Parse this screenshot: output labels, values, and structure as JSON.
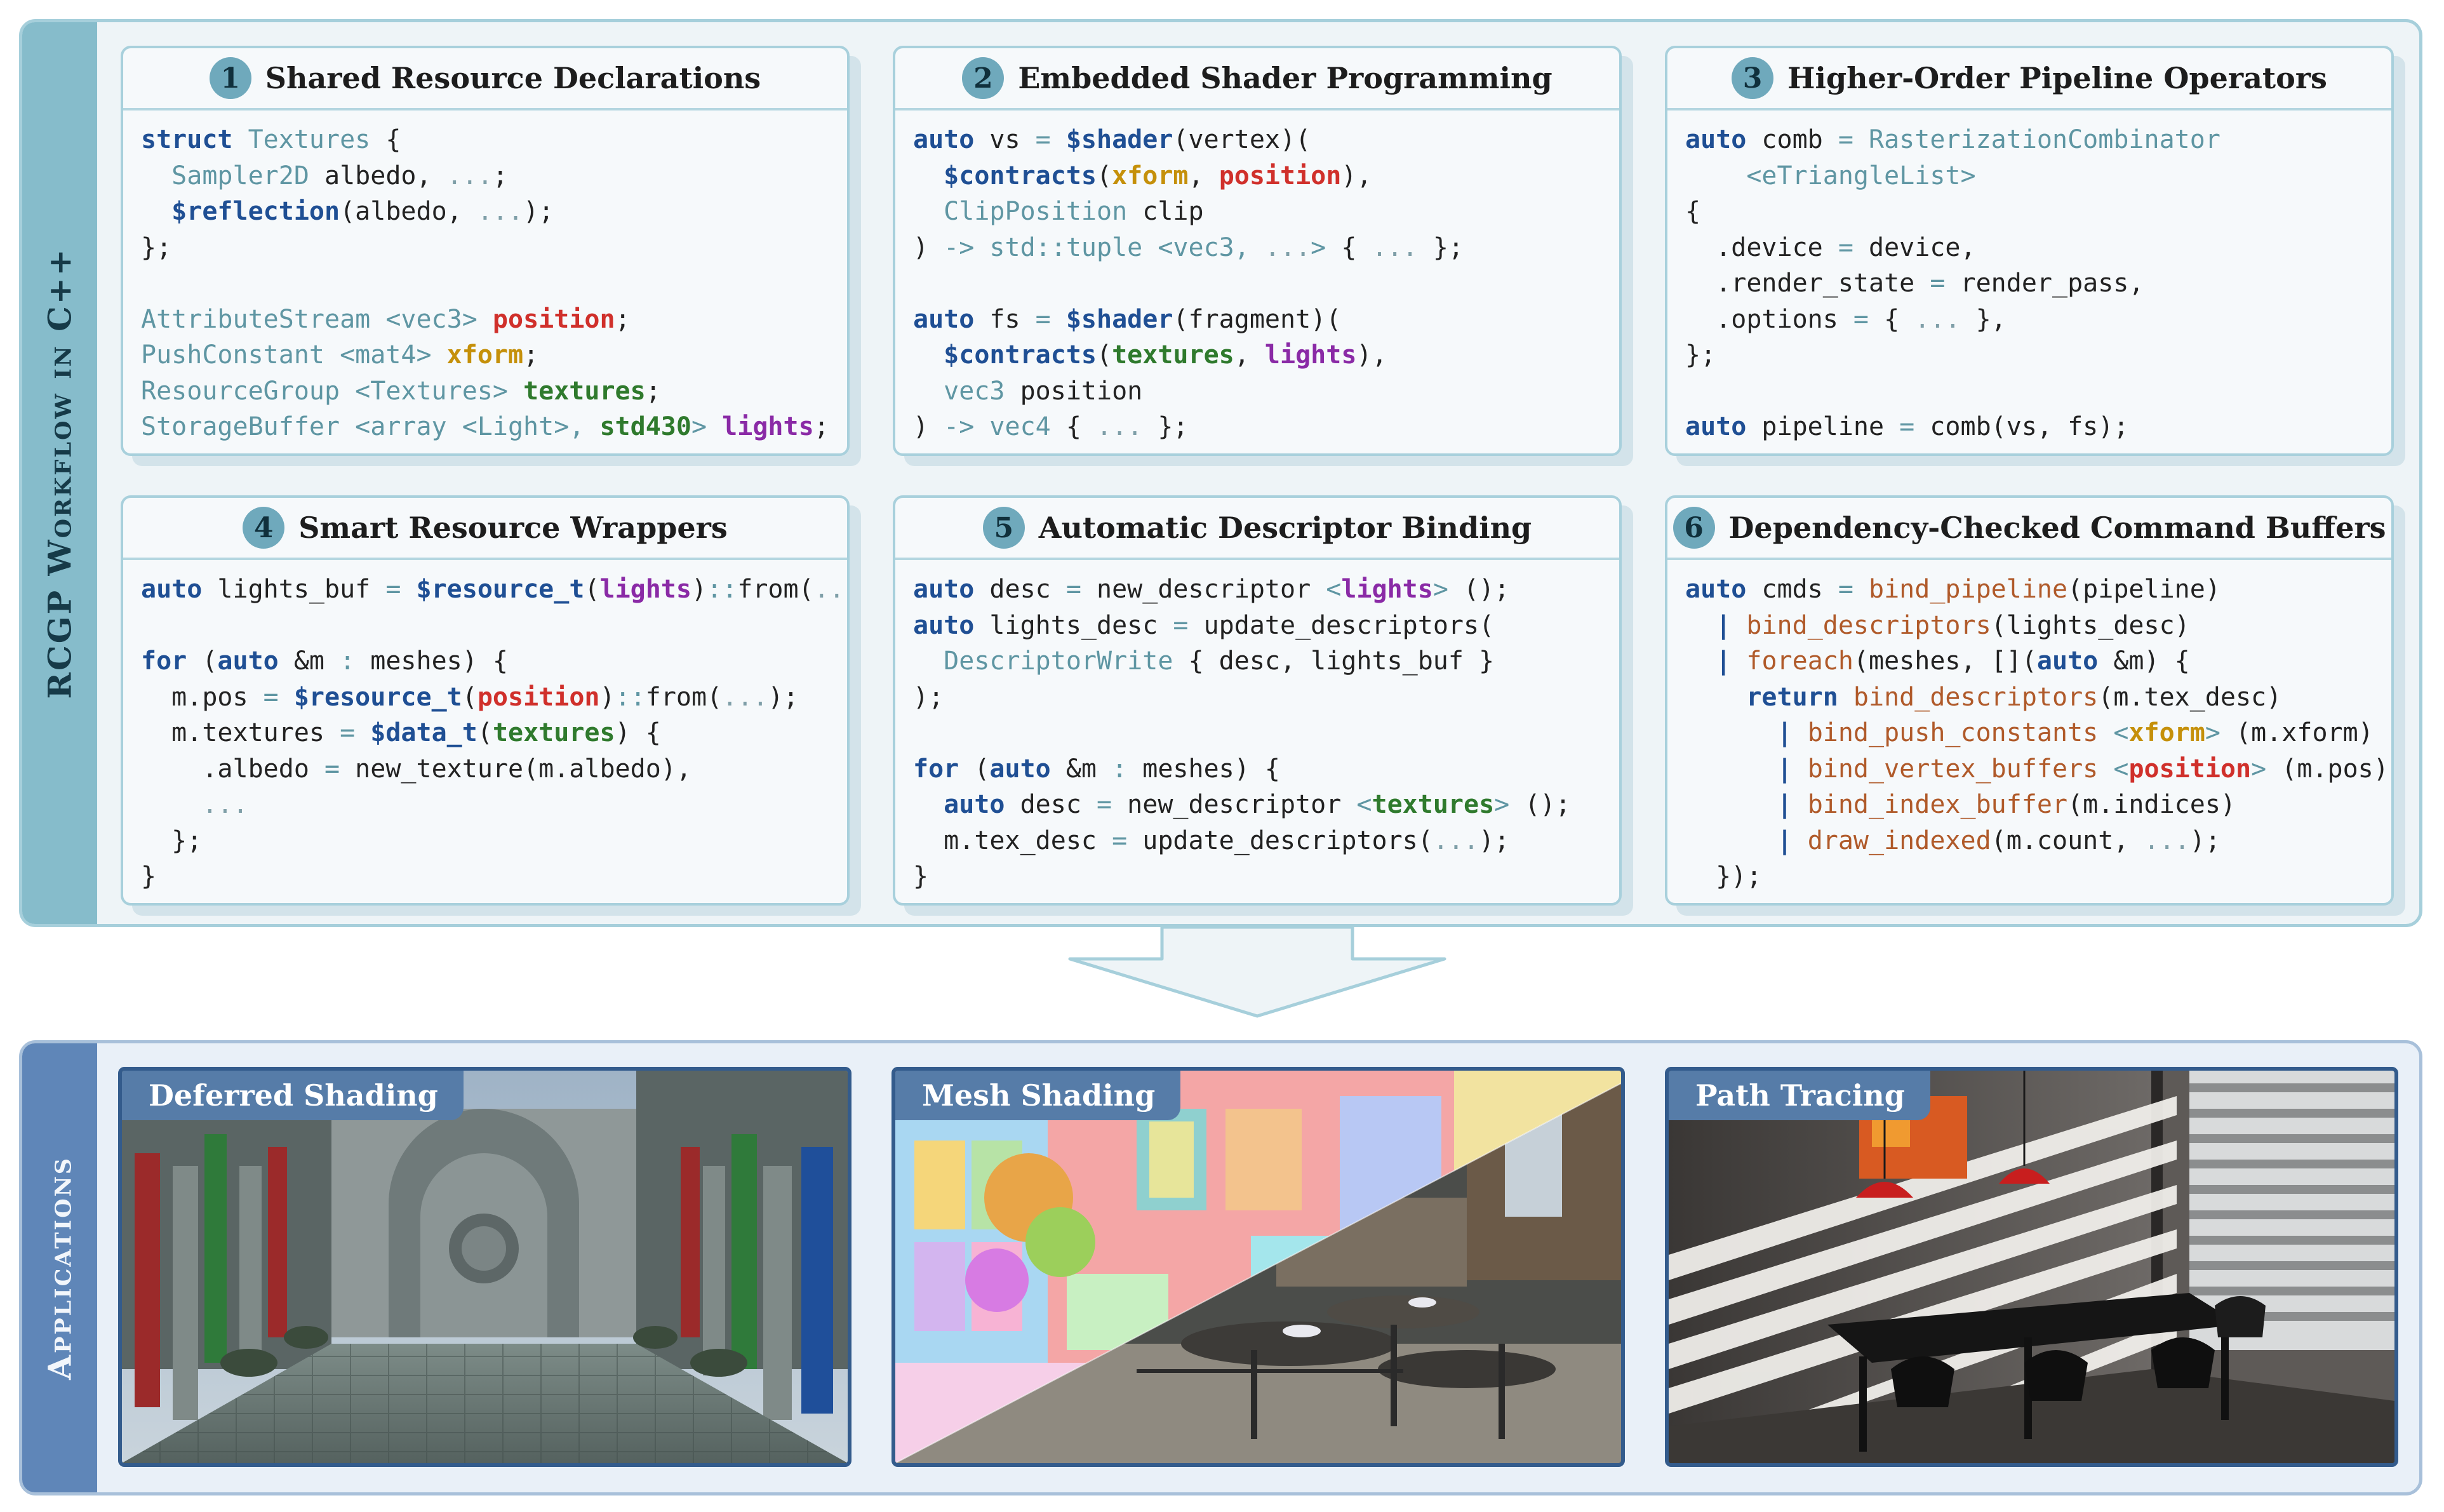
{
  "workflow": {
    "side_label": "RCGP Workflow in C++",
    "cards": [
      {
        "number": "1",
        "title": "Shared Resource Declarations",
        "code": [
          [
            [
              "kw",
              "struct"
            ],
            [
              "n",
              " "
            ],
            [
              "ty",
              "Textures"
            ],
            [
              "n",
              " {"
            ]
          ],
          [
            [
              "n",
              "  "
            ],
            [
              "ty",
              "Sampler2D"
            ],
            [
              "n",
              " albedo, "
            ],
            [
              "dim",
              "..."
            ],
            [
              "n",
              ";"
            ]
          ],
          [
            [
              "n",
              "  "
            ],
            [
              "ann",
              "$reflection"
            ],
            [
              "n",
              "(albedo, "
            ],
            [
              "dim",
              "..."
            ],
            [
              "n",
              ");"
            ]
          ],
          [
            [
              "n",
              "};"
            ]
          ],
          [
            [
              "n",
              ""
            ]
          ],
          [
            [
              "ty",
              "AttributeStream <vec3>"
            ],
            [
              "n",
              " "
            ],
            [
              "red",
              "position"
            ],
            [
              "n",
              ";"
            ]
          ],
          [
            [
              "ty",
              "PushConstant <mat4>"
            ],
            [
              "n",
              " "
            ],
            [
              "ora",
              "xform"
            ],
            [
              "n",
              ";"
            ]
          ],
          [
            [
              "ty",
              "ResourceGroup <Textures>"
            ],
            [
              "n",
              " "
            ],
            [
              "grn",
              "textures"
            ],
            [
              "n",
              ";"
            ]
          ],
          [
            [
              "ty",
              "StorageBuffer <array <Light>, "
            ],
            [
              "grn",
              "std430"
            ],
            [
              "ty",
              ">"
            ],
            [
              "n",
              " "
            ],
            [
              "pur",
              "lights"
            ],
            [
              "n",
              ";"
            ]
          ]
        ]
      },
      {
        "number": "2",
        "title": "Embedded Shader Programming",
        "code": [
          [
            [
              "kw",
              "auto"
            ],
            [
              "n",
              " vs "
            ],
            [
              "ty",
              "="
            ],
            [
              "n",
              " "
            ],
            [
              "ann",
              "$shader"
            ],
            [
              "n",
              "(vertex)("
            ]
          ],
          [
            [
              "n",
              "  "
            ],
            [
              "ann",
              "$contracts"
            ],
            [
              "n",
              "("
            ],
            [
              "ora",
              "xform"
            ],
            [
              "n",
              ", "
            ],
            [
              "red",
              "position"
            ],
            [
              "n",
              "),"
            ]
          ],
          [
            [
              "n",
              "  "
            ],
            [
              "ty",
              "ClipPosition"
            ],
            [
              "n",
              " clip"
            ]
          ],
          [
            [
              "n",
              ") "
            ],
            [
              "ty",
              "-> std::tuple <vec3, "
            ],
            [
              "dim",
              "..."
            ],
            [
              "ty",
              ">"
            ],
            [
              "n",
              " { "
            ],
            [
              "dim",
              "..."
            ],
            [
              "n",
              " };"
            ]
          ],
          [
            [
              "n",
              ""
            ]
          ],
          [
            [
              "kw",
              "auto"
            ],
            [
              "n",
              " fs "
            ],
            [
              "ty",
              "="
            ],
            [
              "n",
              " "
            ],
            [
              "ann",
              "$shader"
            ],
            [
              "n",
              "(fragment)("
            ]
          ],
          [
            [
              "n",
              "  "
            ],
            [
              "ann",
              "$contracts"
            ],
            [
              "n",
              "("
            ],
            [
              "grn",
              "textures"
            ],
            [
              "n",
              ", "
            ],
            [
              "pur",
              "lights"
            ],
            [
              "n",
              "),"
            ]
          ],
          [
            [
              "n",
              "  "
            ],
            [
              "ty",
              "vec3"
            ],
            [
              "n",
              " position"
            ]
          ],
          [
            [
              "n",
              ") "
            ],
            [
              "ty",
              "-> vec4"
            ],
            [
              "n",
              " { "
            ],
            [
              "dim",
              "..."
            ],
            [
              "n",
              " };"
            ]
          ]
        ]
      },
      {
        "number": "3",
        "title": "Higher-Order Pipeline Operators",
        "code": [
          [
            [
              "kw",
              "auto"
            ],
            [
              "n",
              " comb "
            ],
            [
              "ty",
              "="
            ],
            [
              "n",
              " "
            ],
            [
              "ty",
              "RasterizationCombinator"
            ]
          ],
          [
            [
              "n",
              "    "
            ],
            [
              "ty",
              "<eTriangleList>"
            ]
          ],
          [
            [
              "n",
              "{"
            ]
          ],
          [
            [
              "n",
              "  .device "
            ],
            [
              "ty",
              "="
            ],
            [
              "n",
              " device,"
            ]
          ],
          [
            [
              "n",
              "  .render_state "
            ],
            [
              "ty",
              "="
            ],
            [
              "n",
              " render_pass,"
            ]
          ],
          [
            [
              "n",
              "  .options "
            ],
            [
              "ty",
              "="
            ],
            [
              "n",
              " { "
            ],
            [
              "dim",
              "..."
            ],
            [
              "n",
              " },"
            ]
          ],
          [
            [
              "n",
              "};"
            ]
          ],
          [
            [
              "n",
              ""
            ]
          ],
          [
            [
              "kw",
              "auto"
            ],
            [
              "n",
              " pipeline "
            ],
            [
              "ty",
              "="
            ],
            [
              "n",
              " comb(vs, fs);"
            ]
          ]
        ]
      },
      {
        "number": "4",
        "title": "Smart Resource Wrappers",
        "code": [
          [
            [
              "kw",
              "auto"
            ],
            [
              "n",
              " lights_buf "
            ],
            [
              "ty",
              "="
            ],
            [
              "n",
              " "
            ],
            [
              "ann",
              "$resource_t"
            ],
            [
              "n",
              "("
            ],
            [
              "pur",
              "lights"
            ],
            [
              "n",
              ")"
            ],
            [
              "ty",
              "::"
            ],
            [
              "n",
              "from("
            ],
            [
              "dim",
              "..."
            ],
            [
              "n",
              ");"
            ]
          ],
          [
            [
              "n",
              ""
            ]
          ],
          [
            [
              "kw",
              "for"
            ],
            [
              "n",
              " ("
            ],
            [
              "kw",
              "auto"
            ],
            [
              "n",
              " &m "
            ],
            [
              "ty",
              ":"
            ],
            [
              "n",
              " meshes) {"
            ]
          ],
          [
            [
              "n",
              "  m.pos "
            ],
            [
              "ty",
              "="
            ],
            [
              "n",
              " "
            ],
            [
              "ann",
              "$resource_t"
            ],
            [
              "n",
              "("
            ],
            [
              "red",
              "position"
            ],
            [
              "n",
              ")"
            ],
            [
              "ty",
              "::"
            ],
            [
              "n",
              "from("
            ],
            [
              "dim",
              "..."
            ],
            [
              "n",
              ");"
            ]
          ],
          [
            [
              "n",
              "  m.textures "
            ],
            [
              "ty",
              "="
            ],
            [
              "n",
              " "
            ],
            [
              "ann",
              "$data_t"
            ],
            [
              "n",
              "("
            ],
            [
              "grn",
              "textures"
            ],
            [
              "n",
              ") {"
            ]
          ],
          [
            [
              "n",
              "    .albedo "
            ],
            [
              "ty",
              "="
            ],
            [
              "n",
              " new_texture(m.albedo),"
            ]
          ],
          [
            [
              "n",
              "    "
            ],
            [
              "dim",
              "..."
            ]
          ],
          [
            [
              "n",
              "  };"
            ]
          ],
          [
            [
              "n",
              "}"
            ]
          ]
        ]
      },
      {
        "number": "5",
        "title": "Automatic Descriptor Binding",
        "code": [
          [
            [
              "kw",
              "auto"
            ],
            [
              "n",
              " desc "
            ],
            [
              "ty",
              "="
            ],
            [
              "n",
              " new_descriptor "
            ],
            [
              "ty",
              "<"
            ],
            [
              "pur",
              "lights"
            ],
            [
              "ty",
              ">"
            ],
            [
              "n",
              " ();"
            ]
          ],
          [
            [
              "kw",
              "auto"
            ],
            [
              "n",
              " lights_desc "
            ],
            [
              "ty",
              "="
            ],
            [
              "n",
              " update_descriptors("
            ]
          ],
          [
            [
              "n",
              "  "
            ],
            [
              "ty",
              "DescriptorWrite"
            ],
            [
              "n",
              " { desc, lights_buf }"
            ]
          ],
          [
            [
              "n",
              ");"
            ]
          ],
          [
            [
              "n",
              ""
            ]
          ],
          [
            [
              "kw",
              "for"
            ],
            [
              "n",
              " ("
            ],
            [
              "kw",
              "auto"
            ],
            [
              "n",
              " &m "
            ],
            [
              "ty",
              ":"
            ],
            [
              "n",
              " meshes) {"
            ]
          ],
          [
            [
              "n",
              "  "
            ],
            [
              "kw",
              "auto"
            ],
            [
              "n",
              " desc "
            ],
            [
              "ty",
              "="
            ],
            [
              "n",
              " new_descriptor "
            ],
            [
              "ty",
              "<"
            ],
            [
              "grn",
              "textures"
            ],
            [
              "ty",
              ">"
            ],
            [
              "n",
              " ();"
            ]
          ],
          [
            [
              "n",
              "  m.tex_desc "
            ],
            [
              "ty",
              "="
            ],
            [
              "n",
              " update_descriptors("
            ],
            [
              "dim",
              "..."
            ],
            [
              "n",
              ");"
            ]
          ],
          [
            [
              "n",
              "}"
            ]
          ]
        ]
      },
      {
        "number": "6",
        "title": "Dependency-Checked Command Buffers",
        "code": [
          [
            [
              "kw",
              "auto"
            ],
            [
              "n",
              " cmds "
            ],
            [
              "ty",
              "="
            ],
            [
              "n",
              " "
            ],
            [
              "fn",
              "bind_pipeline"
            ],
            [
              "n",
              "(pipeline)"
            ]
          ],
          [
            [
              "n",
              "  "
            ],
            [
              "ann",
              "|"
            ],
            [
              "n",
              " "
            ],
            [
              "fn",
              "bind_descriptors"
            ],
            [
              "n",
              "(lights_desc)"
            ]
          ],
          [
            [
              "n",
              "  "
            ],
            [
              "ann",
              "|"
            ],
            [
              "n",
              " "
            ],
            [
              "fn",
              "foreach"
            ],
            [
              "n",
              "(meshes, []("
            ],
            [
              "kw",
              "auto"
            ],
            [
              "n",
              " &m) {"
            ]
          ],
          [
            [
              "n",
              "    "
            ],
            [
              "kw",
              "return"
            ],
            [
              "n",
              " "
            ],
            [
              "fn",
              "bind_descriptors"
            ],
            [
              "n",
              "(m.tex_desc)"
            ]
          ],
          [
            [
              "n",
              "      "
            ],
            [
              "ann",
              "|"
            ],
            [
              "n",
              " "
            ],
            [
              "fn",
              "bind_push_constants"
            ],
            [
              "n",
              " "
            ],
            [
              "ty",
              "<"
            ],
            [
              "ora",
              "xform"
            ],
            [
              "ty",
              ">"
            ],
            [
              "n",
              " (m.xform)"
            ]
          ],
          [
            [
              "n",
              "      "
            ],
            [
              "ann",
              "|"
            ],
            [
              "n",
              " "
            ],
            [
              "fn",
              "bind_vertex_buffers"
            ],
            [
              "n",
              " "
            ],
            [
              "ty",
              "<"
            ],
            [
              "red",
              "position"
            ],
            [
              "ty",
              ">"
            ],
            [
              "n",
              " (m.pos)"
            ]
          ],
          [
            [
              "n",
              "      "
            ],
            [
              "ann",
              "|"
            ],
            [
              "n",
              " "
            ],
            [
              "fn",
              "bind_index_buffer"
            ],
            [
              "n",
              "(m.indices)"
            ]
          ],
          [
            [
              "n",
              "      "
            ],
            [
              "ann",
              "|"
            ],
            [
              "n",
              " "
            ],
            [
              "fn",
              "draw_indexed"
            ],
            [
              "n",
              "(m.count, "
            ],
            [
              "dim",
              "..."
            ],
            [
              "n",
              ");"
            ]
          ],
          [
            [
              "n",
              "  });"
            ]
          ]
        ]
      }
    ]
  },
  "applications": {
    "side_label": "Applications",
    "items": [
      {
        "label": "Deferred Shading"
      },
      {
        "label": "Mesh Shading"
      },
      {
        "label": "Path Tracing"
      }
    ]
  },
  "colors": {
    "workflow_accent": "#86bccb",
    "applications_accent": "#5f86b8",
    "keyword": "#1f4f94",
    "position": "#d0302b",
    "xform": "#c5900a",
    "textures": "#2f7a2d",
    "lights": "#8a2aa6"
  }
}
